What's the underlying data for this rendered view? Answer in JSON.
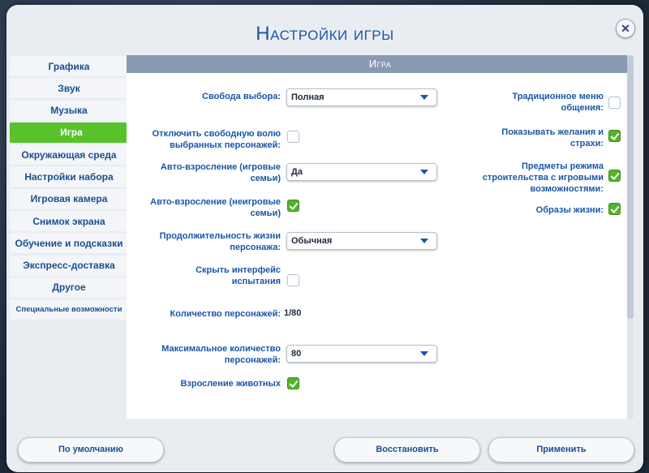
{
  "window": {
    "title": "Настройки игры",
    "close_icon": "close-icon"
  },
  "sidebar": {
    "items": [
      {
        "label": "Графика",
        "active": false
      },
      {
        "label": "Звук",
        "active": false
      },
      {
        "label": "Музыка",
        "active": false
      },
      {
        "label": "Игра",
        "active": true
      },
      {
        "label": "Окружающая среда",
        "active": false
      },
      {
        "label": "Настройки набора",
        "active": false
      },
      {
        "label": "Игровая камера",
        "active": false
      },
      {
        "label": "Снимок экрана",
        "active": false
      },
      {
        "label": "Обучение и подсказки",
        "active": false
      },
      {
        "label": "Экспресс-доставка",
        "active": false
      },
      {
        "label": "Другое",
        "active": false
      },
      {
        "label": "Специальные возможности",
        "active": false
      }
    ]
  },
  "panel": {
    "header": "Игра",
    "left": {
      "free_will": {
        "label": "Свобода выбора:",
        "value": "Полная"
      },
      "disable_free_will": {
        "label": "Отключить свободную волю выбранных персонажей:",
        "checked": false
      },
      "auto_age_played": {
        "label": "Авто-взросление (игровые семьи)",
        "value": "Да"
      },
      "auto_age_unplayed": {
        "label": "Авто-взросление (неигровые семьи)",
        "checked": true
      },
      "lifespan": {
        "label": "Продолжительность жизни персонажа:",
        "value": "Обычная"
      },
      "hide_challenge_ui": {
        "label": "Скрыть интерфейс испытания",
        "checked": false
      },
      "sim_count": {
        "label": "Количество персонажей:",
        "value": "1/80"
      },
      "max_sims": {
        "label": "Максимальное количество персонажей:",
        "value": "80"
      },
      "pet_aging": {
        "label": "Взросление животных",
        "checked": true
      }
    },
    "right": {
      "classic_social_menu": {
        "label": "Традиционное меню общения:",
        "checked": false
      },
      "show_wants_fears": {
        "label": "Показывать желания и страхи:",
        "checked": true
      },
      "build_mode_gameplay": {
        "label": "Предметы режима строительства с игровыми возможностями:",
        "checked": true
      },
      "lifestyles": {
        "label": "Образы жизни:",
        "checked": true
      }
    }
  },
  "footer": {
    "defaults": "По умолчанию",
    "restore": "Восстановить",
    "apply": "Применить"
  },
  "colors": {
    "accent_green": "#57c22a",
    "accent_blue": "#1a56a8",
    "header_bar": "#8a9ab3"
  }
}
